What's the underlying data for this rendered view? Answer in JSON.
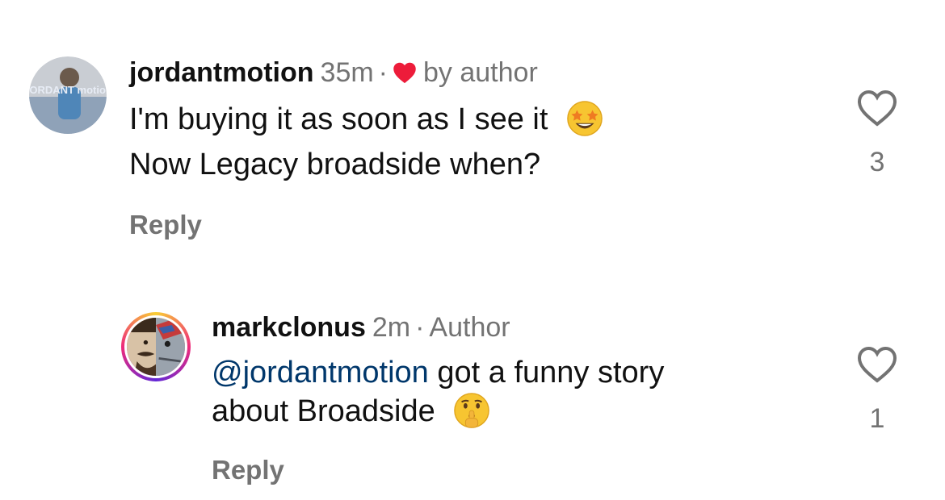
{
  "comments": [
    {
      "username": "jordantmotion",
      "time": "35m",
      "separator": "·",
      "liked_by_author_label": "by author",
      "line1": "I'm buying it as soon as I see it",
      "line2": "Now Legacy broadside when?",
      "emoji_icon": "star-struck-emoji",
      "reply_label": "Reply",
      "like_count": "3",
      "avatar_text": "JORDANT motion"
    },
    {
      "username": "markclonus",
      "time": "2m",
      "separator": "·",
      "author_badge": "Author",
      "mention": "@jordantmotion",
      "text_after_mention": " got a funny story",
      "line2": "about Broadside",
      "emoji_icon": "shushing-face-emoji",
      "reply_label": "Reply",
      "like_count": "1"
    }
  ],
  "colors": {
    "primary_text": "#111111",
    "secondary_text": "#737373",
    "mention": "#00376b",
    "heart_red": "#ed1c3a"
  }
}
